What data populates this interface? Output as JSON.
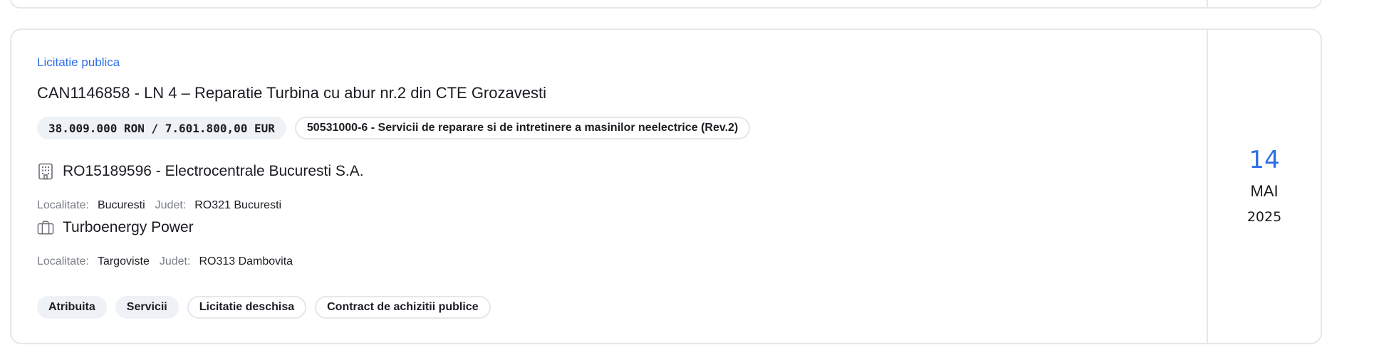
{
  "listing": {
    "procedure_type": "Licitatie publica",
    "title": "CAN1146858 - LN 4 – Reparatie Turbina cu abur nr.2 din CTE Grozavesti",
    "value": "38.009.000 RON / 7.601.800,00 EUR",
    "cpv": "50531000-6 - Servicii de reparare si de intretinere a masinilor neelectrice (Rev.2)",
    "authority": {
      "name": "RO15189596 - Electrocentrale Bucuresti S.A.",
      "icon": "building-icon",
      "locality_label": "Localitate:",
      "locality": "Bucuresti",
      "county_label": "Judet:",
      "county": "RO321 Bucuresti"
    },
    "winner": {
      "name": "Turboenergy Power",
      "icon": "briefcase-icon",
      "locality_label": "Localitate:",
      "locality": "Targoviste",
      "county_label": "Judet:",
      "county": "RO313 Dambovita"
    },
    "tags": [
      "Atribuita",
      "Servicii",
      "Licitatie deschisa",
      "Contract de achizitii publice"
    ],
    "date": {
      "day": "14",
      "month": "MAI",
      "year": "2025"
    }
  },
  "colors": {
    "accent": "#2e6ee6",
    "border": "#e6e7ea",
    "pill_bg": "#eef1f6",
    "muted": "#7a7e87"
  }
}
